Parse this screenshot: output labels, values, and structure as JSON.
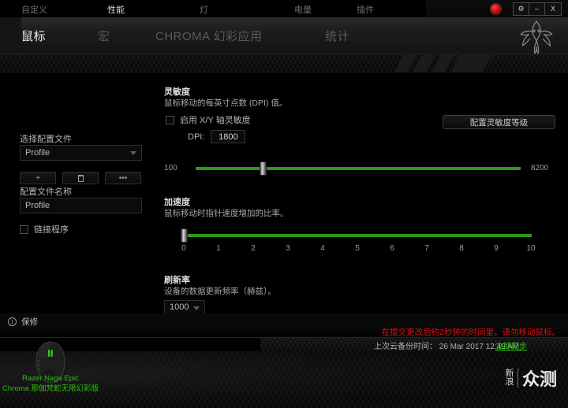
{
  "titlebar": {
    "logo_icon": "razer-orb-icon",
    "settings_label": "⚙",
    "minimize_label": "–",
    "close_label": "X"
  },
  "header": {
    "main_tabs": [
      {
        "label": "鼠标",
        "active": true
      },
      {
        "label": "宏",
        "active": false
      },
      {
        "label": "CHROMA 幻彩应用",
        "active": false
      },
      {
        "label": "统计",
        "active": false
      }
    ],
    "brand_icon": "razer-snake-logo"
  },
  "subtabs": [
    {
      "label": "自定义",
      "active": false
    },
    {
      "label": "性能",
      "active": true
    },
    {
      "label": "灯",
      "active": false
    },
    {
      "label": "电量",
      "active": false
    },
    {
      "label": "插件",
      "active": false
    }
  ],
  "sidebar": {
    "select_profile_label": "选择配置文件",
    "profile_select_value": "Profile",
    "buttons": [
      {
        "name": "add-profile",
        "glyph": "+"
      },
      {
        "name": "delete-profile",
        "glyph": "🗑"
      },
      {
        "name": "more-options",
        "glyph": "•••"
      }
    ],
    "profile_name_label": "配置文件名称",
    "profile_name_value": "Profile",
    "link_program_label": "链接程序",
    "link_program_checked": false
  },
  "main": {
    "sensitivity": {
      "title": "灵敏度",
      "description": "鼠标移动的每英寸点数 (DPI) 值。",
      "xy_checkbox_label": "启用 X/Y 轴灵敏度",
      "xy_checkbox_checked": false,
      "dpi_label": "DPI:",
      "dpi_value": "1800",
      "configure_button": "配置灵敏度等级",
      "slider_min_label": "100",
      "slider_max_label": "8200",
      "slider_min": 100,
      "slider_max": 8200,
      "slider_value": 1800
    },
    "acceleration": {
      "title": "加速度",
      "description": "鼠标移动时指针速度增加的比率。",
      "ticks": [
        "0",
        "1",
        "2",
        "3",
        "4",
        "5",
        "6",
        "7",
        "8",
        "9",
        "10"
      ],
      "slider_min": 0,
      "slider_max": 10,
      "slider_value": 0
    },
    "polling": {
      "title": "刷新率",
      "description": "设备的数据更新频率（赫兹）。",
      "value": "1000"
    }
  },
  "footer": {
    "warranty_label": "保修",
    "warranty_icon": "info-icon",
    "warning_text": "在提交更改后约2秒钟的时间里，请勿移动鼠标。",
    "sync_text": "上次云备份时间： 26 Mar 2017 12:49 AM",
    "sync_link": "立即同步"
  },
  "device": {
    "image_icon": "razer-naga-mouse",
    "name": "Razer Naga Epic\nChroma 那伽梵蛇无限幻彩版"
  },
  "watermark": {
    "left_line1": "新",
    "left_line2": "浪",
    "right": "众测"
  },
  "colors": {
    "accent_green": "#2a9a14",
    "warning_red": "#e01010",
    "link_green": "#2fbf12"
  }
}
